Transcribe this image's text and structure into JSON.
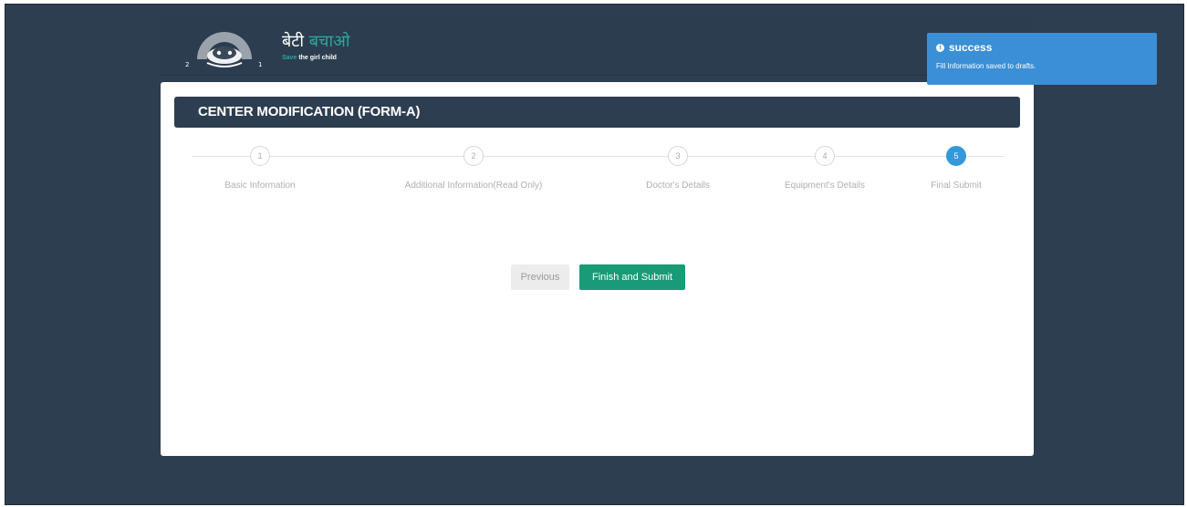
{
  "logo": {
    "hindi_white": "बेटी",
    "hindi_accent": "बचाओ",
    "tag_accent": "Save",
    "tag_white": "the girl child"
  },
  "form": {
    "title": "CENTER MODIFICATION (FORM-A)"
  },
  "stepper": {
    "active_step": 5,
    "steps": [
      {
        "number": "1",
        "label": "Basic Information"
      },
      {
        "number": "2",
        "label": "Additional Information(Read Only)"
      },
      {
        "number": "3",
        "label": "Doctor's Details"
      },
      {
        "number": "4",
        "label": "Equipment's Details"
      },
      {
        "number": "5",
        "label": "Final Submit"
      }
    ]
  },
  "buttons": {
    "previous": "Previous",
    "submit": "Finish and Submit"
  },
  "toast": {
    "icon": "info-icon",
    "title": "success",
    "message": "Fill Information saved to drafts."
  },
  "colors": {
    "background": "#2c3e50",
    "submit": "#1a9a77",
    "active_step": "#3498db",
    "toast": "#3a8fd6",
    "logo_accent": "#2aa8a0"
  }
}
